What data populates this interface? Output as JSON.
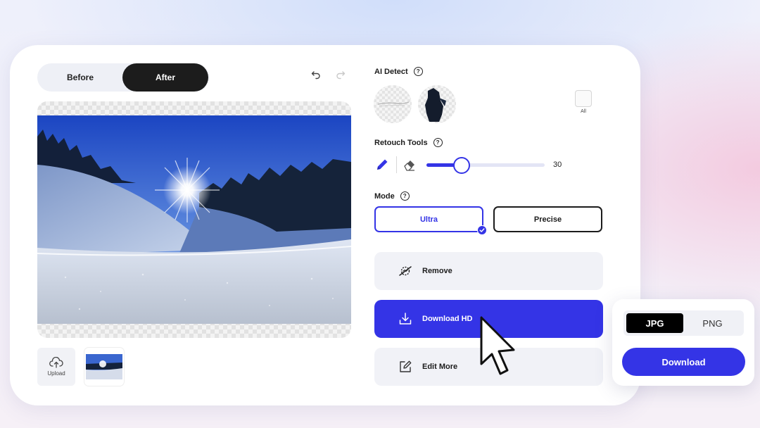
{
  "compare": {
    "before_label": "Before",
    "after_label": "After",
    "active": "After"
  },
  "history": {
    "undo_icon": "undo-icon",
    "redo_icon": "redo-icon"
  },
  "thumbnails": {
    "upload_label": "Upload"
  },
  "ai_detect": {
    "title": "AI Detect",
    "all_label": "All"
  },
  "retouch": {
    "title": "Retouch Tools",
    "brush_size": 30,
    "brush_min": 0,
    "brush_max": 100
  },
  "mode": {
    "title": "Mode",
    "options": [
      "Ultra",
      "Precise"
    ],
    "selected": "Ultra"
  },
  "actions": {
    "remove": "Remove",
    "download_hd": "Download HD",
    "edit_more": "Edit More"
  },
  "download_popover": {
    "formats": [
      "JPG",
      "PNG"
    ],
    "selected_format": "JPG",
    "download_label": "Download"
  },
  "colors": {
    "accent": "#3434e6",
    "dark": "#1c1c1c",
    "panel": "#f1f2f7"
  }
}
